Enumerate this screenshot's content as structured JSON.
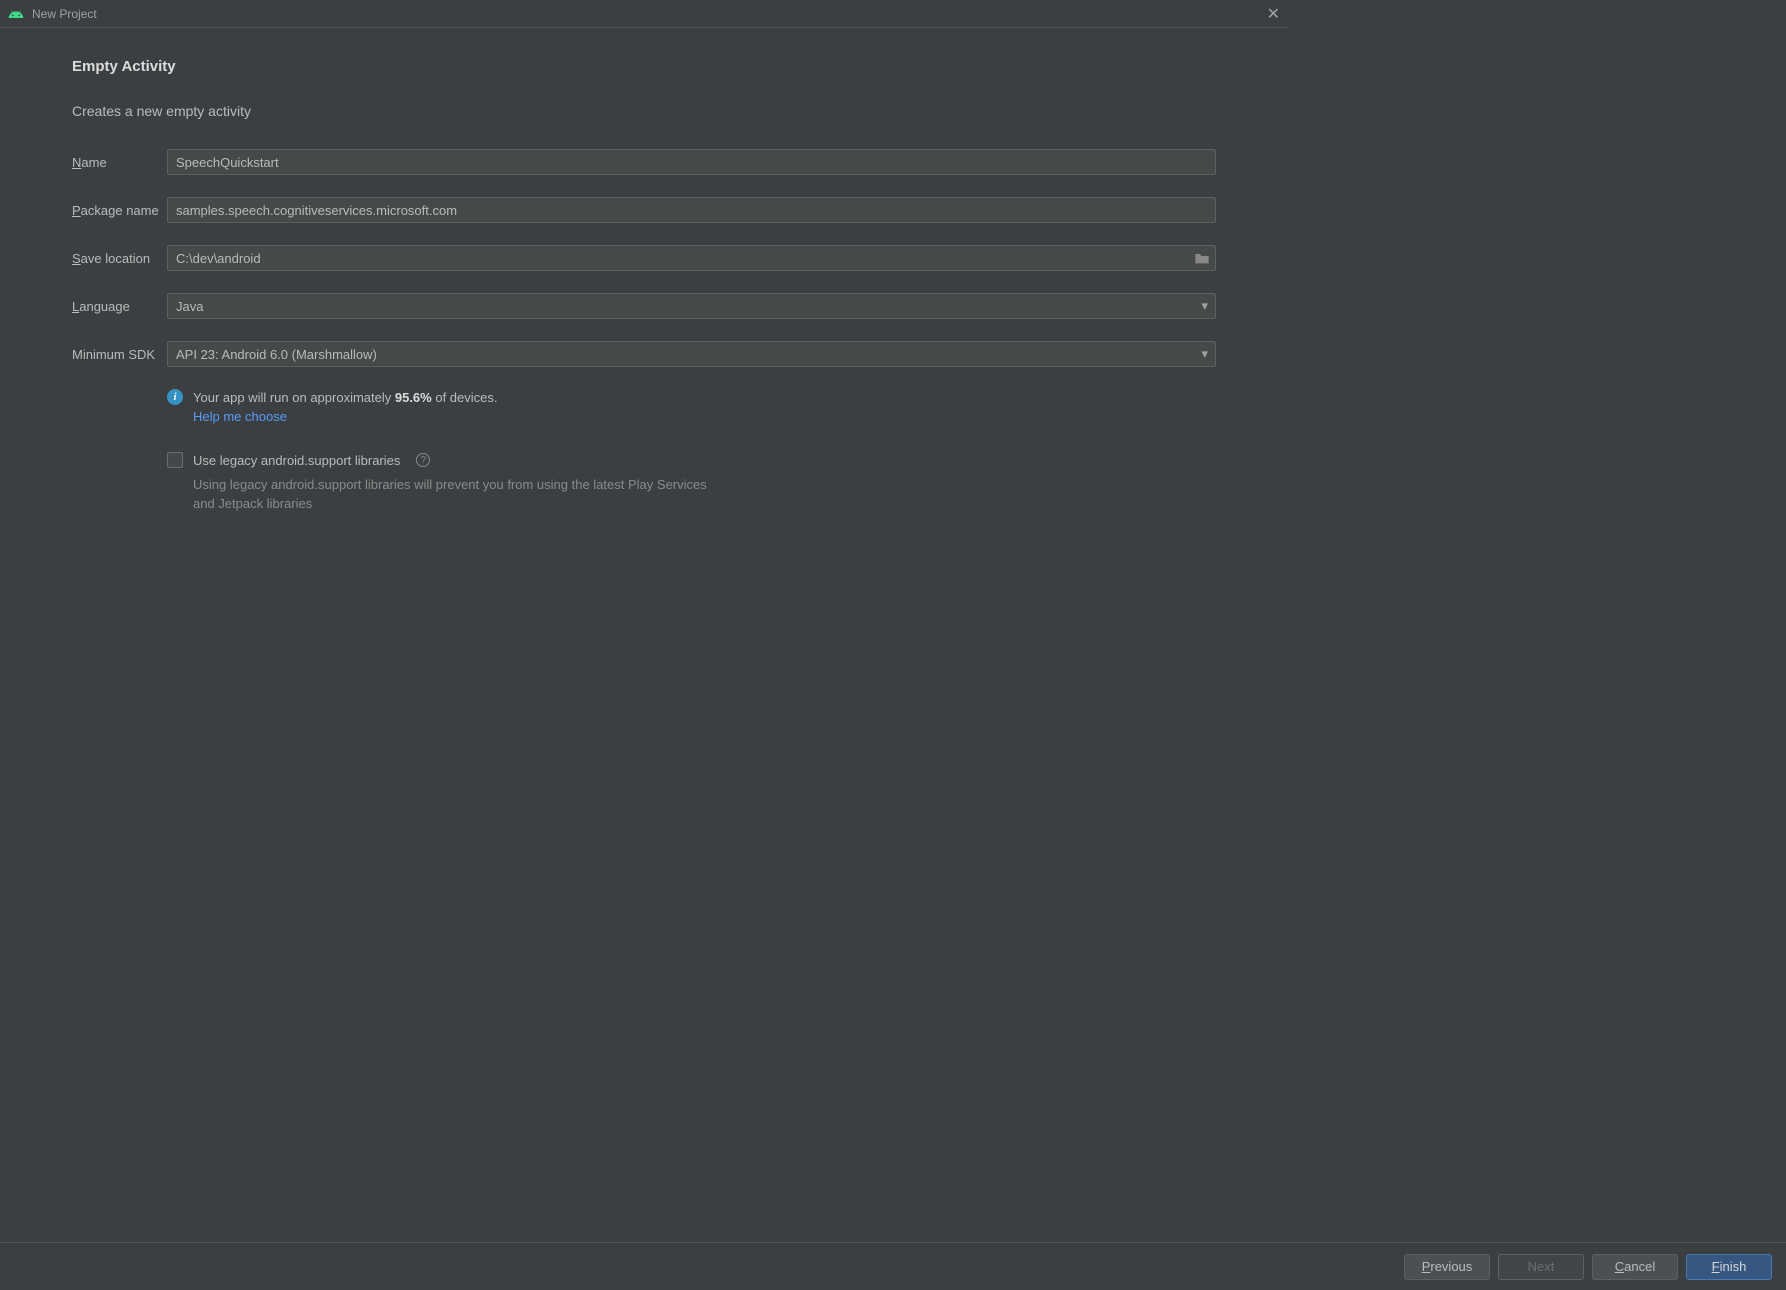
{
  "window": {
    "title": "New Project"
  },
  "page": {
    "heading": "Empty Activity",
    "subtitle": "Creates a new empty activity"
  },
  "form": {
    "name_label": "ame",
    "name_value": "SpeechQuickstart",
    "package_label": "ackage name",
    "package_value": "samples.speech.cognitiveservices.microsoft.com",
    "save_label": "ave location",
    "save_value": "C:\\dev\\android",
    "language_label": "anguage",
    "language_value": "Java",
    "minsdk_label": "Minimum SDK",
    "minsdk_value": "API 23: Android 6.0 (Marshmallow)"
  },
  "info": {
    "pre": "Your app will run on approximately ",
    "percent": "95.6%",
    "post": " of devices.",
    "help_link": "Help me choose"
  },
  "legacy": {
    "label": "Use legacy android.support libraries",
    "help": "Using legacy android.support libraries will prevent you from using the latest Play Services and Jetpack libraries"
  },
  "buttons": {
    "previous": "revious",
    "next": "Next",
    "cancel": "ancel",
    "finish": "inish"
  }
}
